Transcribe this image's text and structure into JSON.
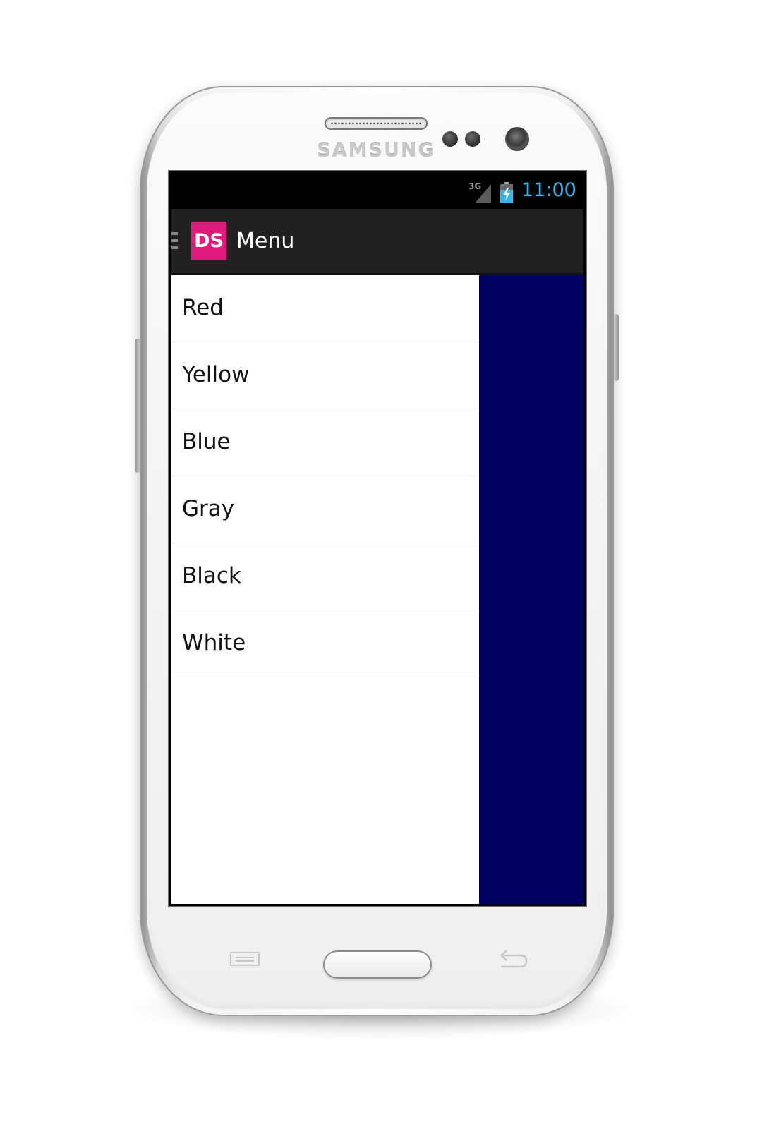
{
  "device": {
    "brand": "SAMSUNG"
  },
  "status_bar": {
    "network": "3G",
    "time": "11:00",
    "accent_color": "#33b5e5",
    "icons": [
      "signal-icon",
      "battery-charging-icon"
    ]
  },
  "action_bar": {
    "logo_text": "DS",
    "logo_color": "#e0197d",
    "title": "Menu",
    "background": "#212121"
  },
  "drawer": {
    "items": [
      {
        "label": "Red"
      },
      {
        "label": "Yellow"
      },
      {
        "label": "Blue"
      },
      {
        "label": "Gray"
      },
      {
        "label": "Black"
      },
      {
        "label": "White"
      }
    ]
  },
  "main": {
    "background_color": "#000060"
  },
  "hardware_keys": [
    "menu-key-icon",
    "home-button",
    "back-key-icon"
  ]
}
